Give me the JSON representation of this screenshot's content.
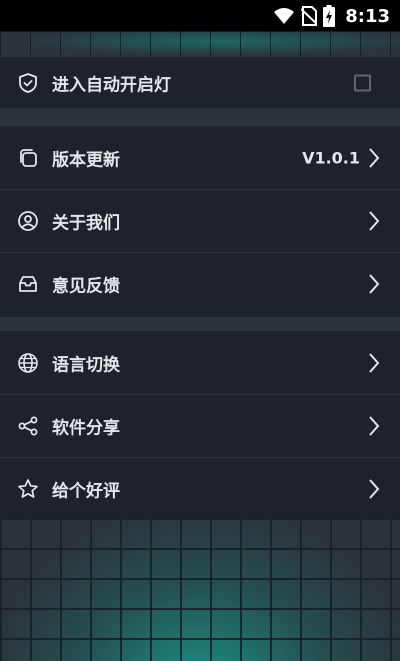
{
  "status_bar": {
    "time": "8:13"
  },
  "settings": {
    "auto_light": {
      "label": "进入自动开启灯",
      "checked": false
    },
    "version": {
      "label": "版本更新",
      "value": "V1.0.1"
    },
    "about": {
      "label": "关于我们"
    },
    "feedback": {
      "label": "意见反馈"
    },
    "language": {
      "label": "语言切换"
    },
    "share": {
      "label": "软件分享"
    },
    "rate": {
      "label": "给个好评"
    }
  }
}
